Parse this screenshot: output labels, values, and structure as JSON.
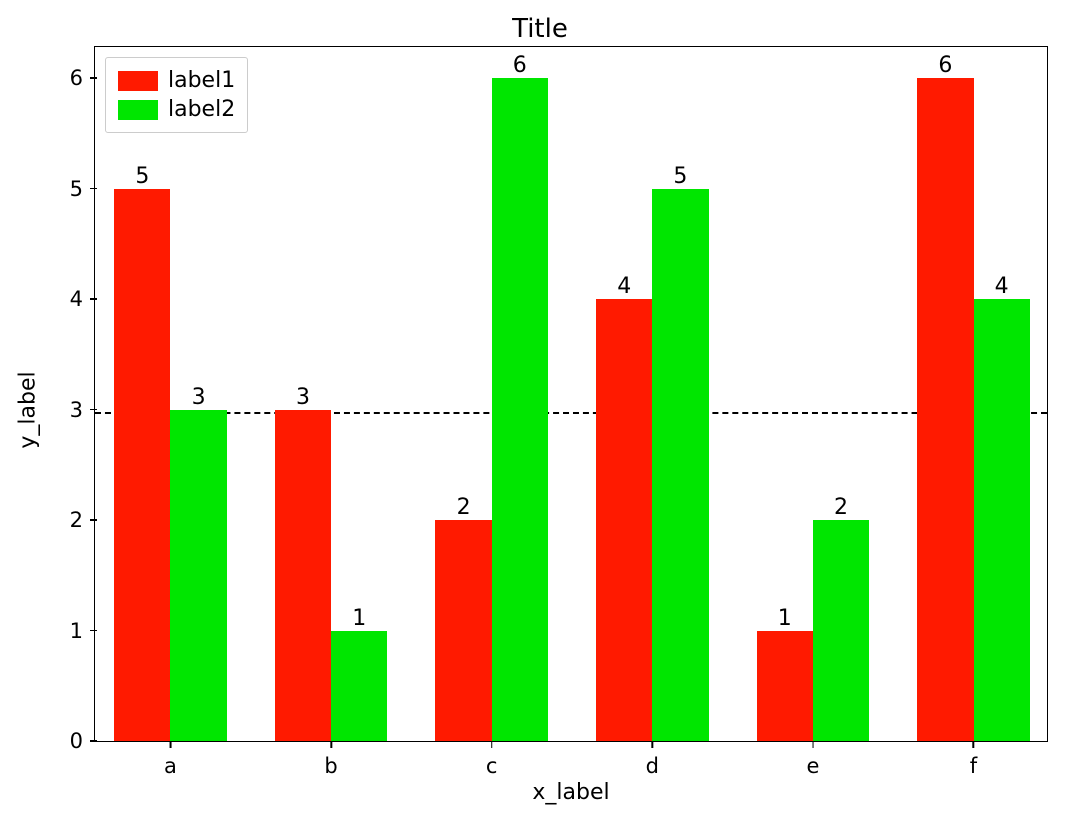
{
  "chart_data": {
    "type": "bar",
    "title": "Title",
    "xlabel": "x_label",
    "ylabel": "y_label",
    "categories": [
      "a",
      "b",
      "c",
      "d",
      "e",
      "f"
    ],
    "series": [
      {
        "name": "label1",
        "color": "#ff1a00",
        "values": [
          5,
          3,
          2,
          4,
          1,
          6
        ]
      },
      {
        "name": "label2",
        "color": "#00e600",
        "values": [
          3,
          1,
          6,
          5,
          2,
          4
        ]
      }
    ],
    "ylim": [
      0,
      6.3
    ],
    "yticks": [
      0,
      1,
      2,
      3,
      4,
      5,
      6
    ],
    "hline_y": 3,
    "legend_position": "upper left",
    "bar_width": 0.35
  }
}
